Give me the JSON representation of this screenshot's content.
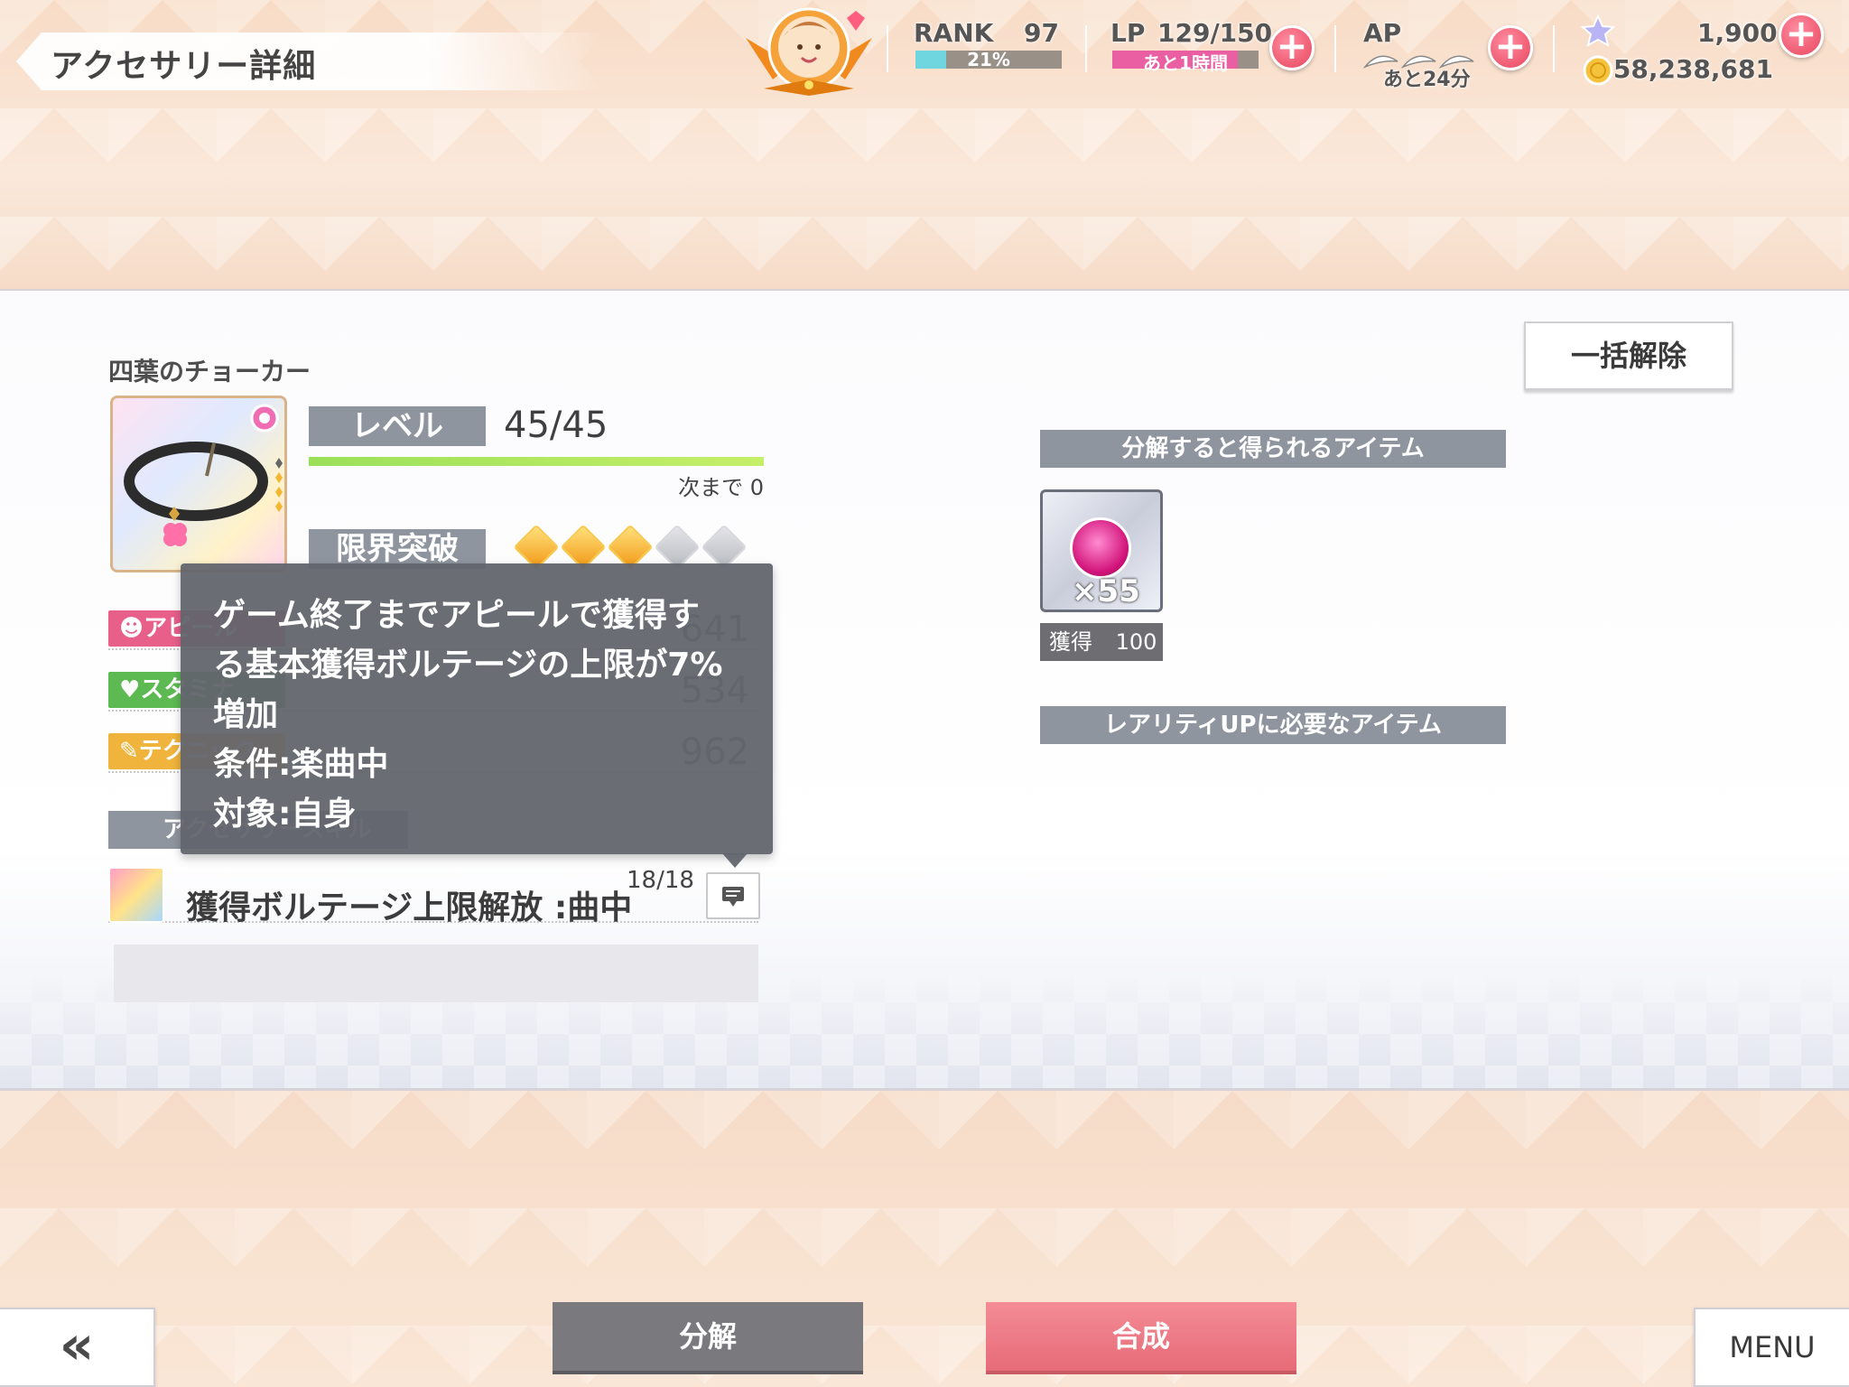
{
  "header": {
    "title": "アクセサリー詳細",
    "rank_label": "RANK",
    "rank_value": "97",
    "rank_progress_text": "21%",
    "rank_progress": 0.21,
    "lp_label": "LP",
    "lp_value": "129/150",
    "lp_timer": "あと1時間",
    "lp_progress": 0.86,
    "ap_label": "AP",
    "ap_timer": "あと24分",
    "stars_value": "1,900",
    "gold_value": "58,238,681"
  },
  "accessory": {
    "name": "四葉のチョーカー",
    "level_label": "レベル",
    "level_value": "45/45",
    "next_text": "次まで 0",
    "limit_label": "限界突破",
    "limit_stars_filled": 3,
    "limit_stars_total": 5
  },
  "stats": [
    {
      "label": "アピール",
      "value": "641",
      "color": "#e8608a"
    },
    {
      "label": "スタミナ",
      "value": "534",
      "color": "#5dba52"
    },
    {
      "label": "テクニック",
      "value": "962",
      "color": "#f0b43c"
    }
  ],
  "skill": {
    "section_label": "アクセサリースキル",
    "name": "獲得ボルテージ上限解放 :曲中",
    "count": "18/18"
  },
  "tooltip": {
    "line1": "ゲーム終了までアピールで獲得す",
    "line2": "る基本獲得ボルテージの上限が7%",
    "line3": "増加",
    "line4": "条件:楽曲中",
    "line5": "対象:自身"
  },
  "right": {
    "release_all_label": "一括解除",
    "decompose_items_label": "分解すると得られるアイテム",
    "item_qty": "×55",
    "obtain_label": "獲得",
    "obtain_value": "100",
    "rarity_items_label": "レアリティUPに必要なアイテム"
  },
  "footer": {
    "back_label": "«",
    "decompose_label": "分解",
    "fuse_label": "合成",
    "menu_label": "MENU"
  }
}
